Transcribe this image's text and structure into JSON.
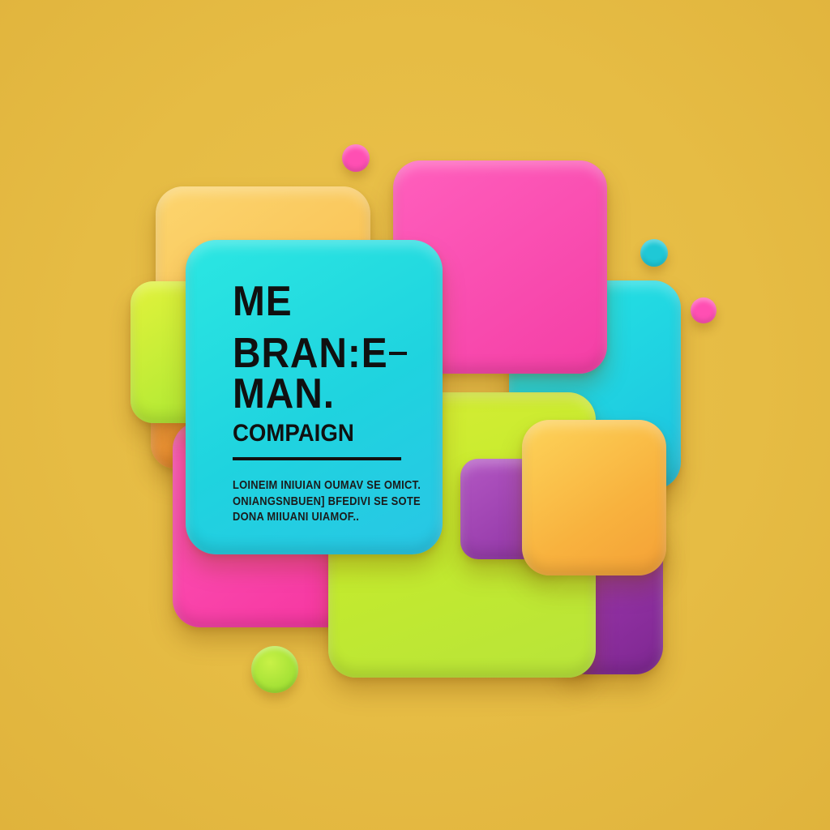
{
  "card": {
    "headline_line1": "ME",
    "headline_line2": "BRAN:E",
    "headline_line3": "MAN.",
    "subheading": "COMPAIGN",
    "body_line1": "LOINEIM INIUIAN OUMAV SE OMICT.",
    "body_line2": "ONIANGSNBUEN] BFEDIVI SE SOTE",
    "body_line3": "DONA MIIUANI UIAMOF.."
  },
  "colors": {
    "background": "#e6bd45",
    "cyan": "#22d9e0",
    "magenta": "#ff4fb3",
    "lime": "#c6ef3a",
    "orange": "#fbc04b",
    "purple": "#8a2c9a",
    "text": "#101010"
  }
}
